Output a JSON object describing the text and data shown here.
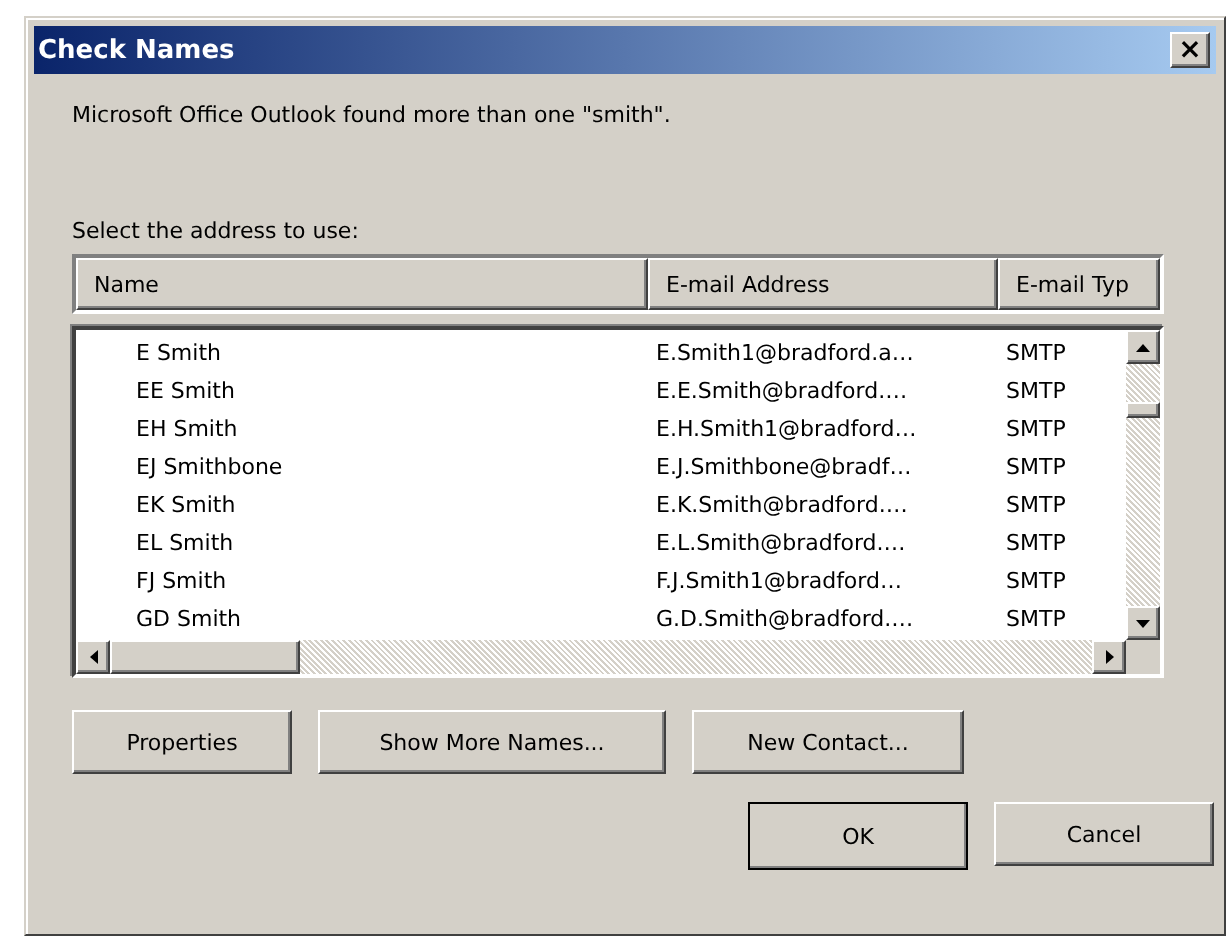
{
  "window": {
    "title": "Check Names",
    "close": "×"
  },
  "message": "Microsoft Office Outlook found more than one \"smith\".",
  "list_label": "Select the address to use:",
  "table": {
    "columns": [
      "Name",
      "E-mail Address",
      "E-mail Typ"
    ],
    "rows": [
      {
        "name": "E Smith",
        "email": "E.Smith1@bradford.a…",
        "type": "SMTP"
      },
      {
        "name": "EE Smith",
        "email": "E.E.Smith@bradford.…",
        "type": "SMTP"
      },
      {
        "name": "EH Smith",
        "email": "E.H.Smith1@bradford…",
        "type": "SMTP"
      },
      {
        "name": "EJ Smithbone",
        "email": "E.J.Smithbone@bradf…",
        "type": "SMTP"
      },
      {
        "name": "EK Smith",
        "email": "E.K.Smith@bradford.…",
        "type": "SMTP"
      },
      {
        "name": "EL Smith",
        "email": "E.L.Smith@bradford.…",
        "type": "SMTP"
      },
      {
        "name": "FJ Smith",
        "email": "F.J.Smith1@bradford…",
        "type": "SMTP"
      },
      {
        "name": "GD Smith",
        "email": "G.D.Smith@bradford.…",
        "type": "SMTP"
      }
    ]
  },
  "action_buttons": [
    {
      "label": "Properties",
      "default": false
    },
    {
      "label": "Show More Names...",
      "default": false
    },
    {
      "label": "New Contact...",
      "default": false
    }
  ],
  "dialog_buttons": [
    {
      "label": "OK",
      "default": true
    },
    {
      "label": "Cancel",
      "default": false
    }
  ]
}
